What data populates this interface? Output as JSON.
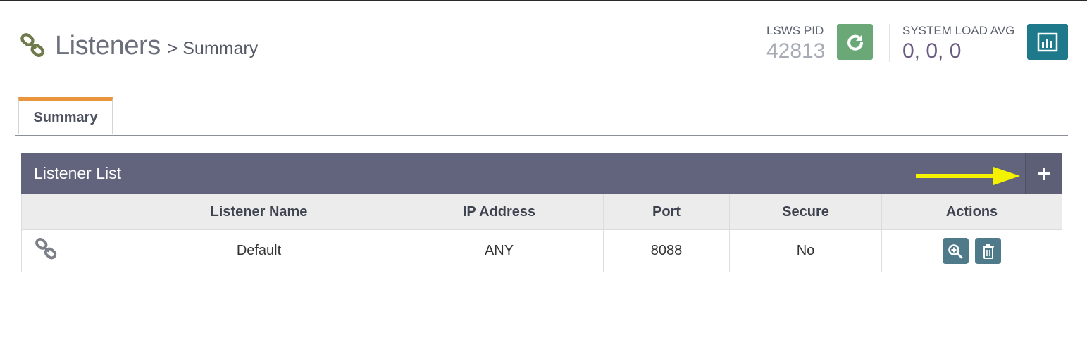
{
  "header": {
    "title": "Listeners",
    "subtitle": "> Summary"
  },
  "stats": {
    "pid_label": "LSWS PID",
    "pid_value": "42813",
    "load_label": "SYSTEM LOAD AVG",
    "load_value": "0, 0, 0"
  },
  "tabs": [
    {
      "label": "Summary",
      "active": true
    }
  ],
  "panel": {
    "title": "Listener List",
    "columns": [
      "",
      "Listener Name",
      "IP Address",
      "Port",
      "Secure",
      "Actions"
    ],
    "rows": [
      {
        "name": "Default",
        "ip": "ANY",
        "port": "8088",
        "secure": "No"
      }
    ]
  },
  "icons": {
    "page": "link-icon",
    "restart": "refresh-icon",
    "load": "bar-chart-icon",
    "add": "plus-icon",
    "row": "link-icon",
    "view": "zoom-in-icon",
    "delete": "trash-icon"
  },
  "colors": {
    "accent_tab": "#e9953c",
    "panel_header": "#61647c",
    "restart_button": "#6aa878",
    "load_button": "#1e7a8a",
    "action_button": "#4f7a8a",
    "annotation_arrow": "#f5f200"
  }
}
